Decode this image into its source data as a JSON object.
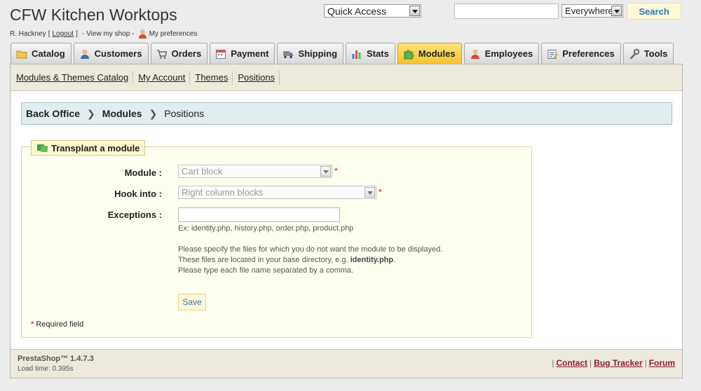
{
  "header": {
    "shop_title": "CFW Kitchen Worktops",
    "user_name": "R. Hackney",
    "logout_bracket_open": "[",
    "logout_label": "Logout",
    "logout_bracket_close": "]",
    "dash": "-",
    "view_shop_label": "View my shop",
    "preferences_label": "My preferences",
    "quick_access_value": "Quick Access",
    "search_value": "",
    "search_scope_value": "Everywhere",
    "search_button_label": "Search"
  },
  "tabs": [
    {
      "label": "Catalog",
      "icon": "folder-icon"
    },
    {
      "label": "Customers",
      "icon": "customer-icon"
    },
    {
      "label": "Orders",
      "icon": "cart-icon"
    },
    {
      "label": "Payment",
      "icon": "calendar-icon"
    },
    {
      "label": "Shipping",
      "icon": "truck-icon"
    },
    {
      "label": "Stats",
      "icon": "bar-chart-icon"
    },
    {
      "label": "Modules",
      "icon": "puzzle-icon",
      "active": true
    },
    {
      "label": "Employees",
      "icon": "employee-icon"
    },
    {
      "label": "Preferences",
      "icon": "preferences-icon"
    },
    {
      "label": "Tools",
      "icon": "wrench-icon"
    }
  ],
  "subnav": [
    {
      "label": "Modules & Themes Catalog"
    },
    {
      "label": "My Account"
    },
    {
      "label": "Themes"
    },
    {
      "label": "Positions"
    }
  ],
  "breadcrumb": {
    "items": [
      "Back Office",
      "Modules",
      "Positions"
    ],
    "separator": ">"
  },
  "form": {
    "legend": "Transplant a module",
    "module_label": "Module :",
    "module_value": "Cart block",
    "hook_label": "Hook into :",
    "hook_value": "Right column blocks",
    "exceptions_label": "Exceptions :",
    "exceptions_value": "",
    "required_mark": "*",
    "example_hint": "Ex: identity.php, history.php, order.php, product.php",
    "help_line_1": "Please specify the files for which you do not want the module to be displayed.",
    "help_line_2_prefix": "These files are located in your base directory, e.g.",
    "help_line_2_code": "identity.php",
    "help_line_2_suffix": ".",
    "help_line_3": "Please type each file name separated by a comma.",
    "save_label": "Save",
    "required_note": "Required field"
  },
  "footer": {
    "version": "PrestaShop™ 1.4.7.3",
    "load_time": "Load time: 0.395s",
    "pipe": "|",
    "links": [
      "Contact",
      "Bug Tracker",
      "Forum"
    ]
  },
  "colors": {
    "active_tab": "#f4c22f",
    "link_accent": "#8a1a3a",
    "button_text": "#2a7ab8"
  }
}
